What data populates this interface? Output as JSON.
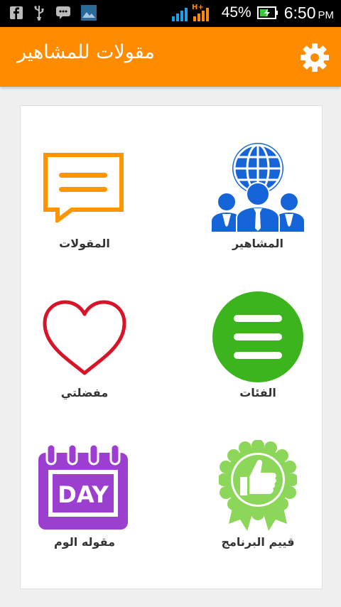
{
  "status_bar": {
    "battery_percent": "45%",
    "time": "6:50",
    "ampm": "PM",
    "network": "H+",
    "icons": [
      "facebook-icon",
      "usb-icon",
      "chat-icon",
      "image-icon",
      "signal-icon",
      "battery-charging-icon"
    ]
  },
  "app_bar": {
    "title": "مقولات للمشاهير",
    "settings_icon": "gear-icon",
    "color": "#ff8c00"
  },
  "tiles": [
    {
      "label": "المشاهير",
      "icon": "celebrities-icon"
    },
    {
      "label": "المقولات",
      "icon": "speech-bubble-icon"
    },
    {
      "label": "الفئات",
      "icon": "menu-list-icon"
    },
    {
      "label": "مفضلتي",
      "icon": "heart-icon"
    },
    {
      "label": "قييم البرنامج",
      "icon": "thumbs-up-badge-icon"
    },
    {
      "label": "مقوله الوم",
      "icon": "calendar-day-icon",
      "badge_text": "DAY"
    }
  ]
}
